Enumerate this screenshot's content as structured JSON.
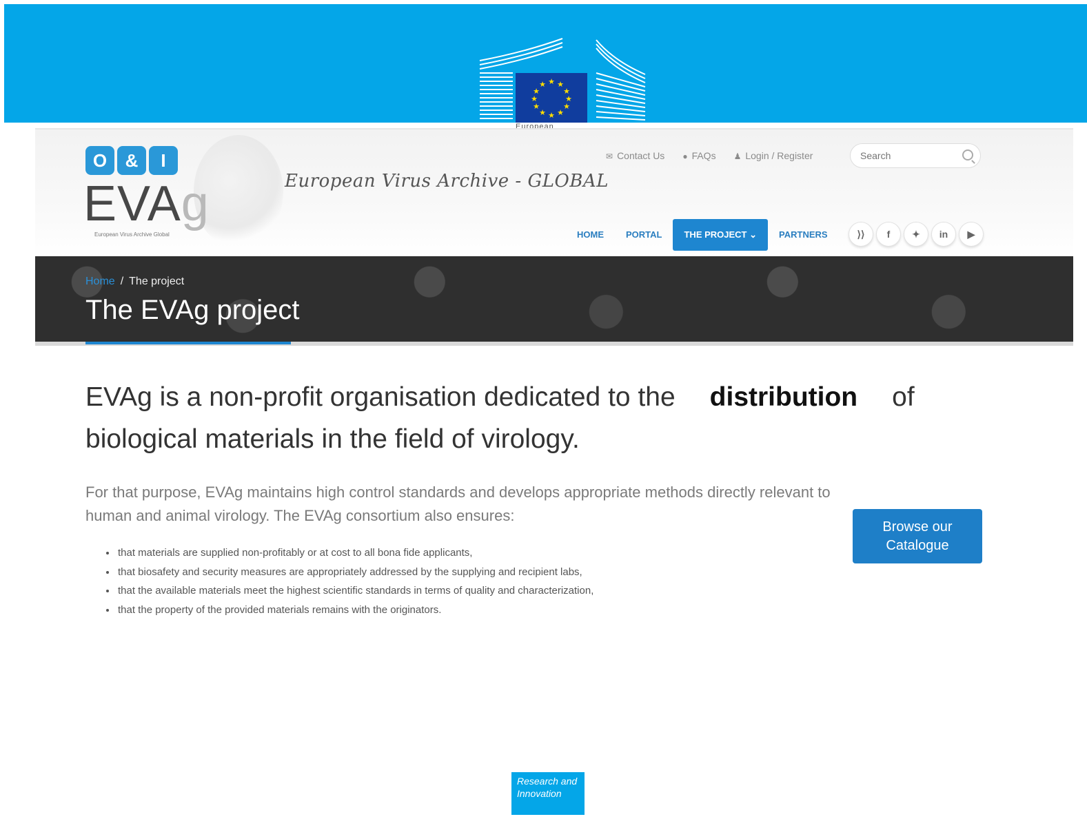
{
  "eu_banner": {
    "logo_caption": "European",
    "colors": {
      "banner": "#04a6e8",
      "flag": "#103d9e",
      "stars": "#ffdd00"
    }
  },
  "logo": {
    "badges": [
      "O",
      "&",
      "I"
    ],
    "main": "EVA",
    "main_suffix": "g",
    "subtitle": "European Virus Archive Global"
  },
  "tagline": "European Virus Archive - GLOBAL",
  "utility_links": [
    {
      "icon": "envelope-icon",
      "label": "Contact Us"
    },
    {
      "icon": "chat-icon",
      "label": "FAQs"
    },
    {
      "icon": "user-icon",
      "label": "Login / Register"
    }
  ],
  "search": {
    "placeholder": "Search"
  },
  "nav": {
    "home": "HOME",
    "portal": "PORTAL",
    "project": "THE PROJECT ⌄",
    "partners": "PARTNERS"
  },
  "social": {
    "rss": "⟩⟩",
    "facebook": "f",
    "twitter": "✦",
    "linkedin": "in",
    "youtube": "▶"
  },
  "breadcrumb": {
    "home": "Home",
    "separator": "/",
    "current": "The project"
  },
  "page_title": "The EVAg project",
  "lead": {
    "before": "EVAg is a non-profit organisation dedicated to the",
    "bold": "distribution",
    "after": "of biological materials in the field of virology."
  },
  "paragraph": "For that purpose, EVAg maintains high control standards and develops appropriate methods directly relevant to human and animal virology. The EVAg consortium also ensures:",
  "bullets": [
    "that materials are supplied non-profitably or at cost to all bona fide applicants,",
    "that biosafety and security measures are appropriately addressed by the supplying and recipient labs,",
    "that the available materials meet the highest scientific standards in terms of quality and characterization,",
    "that the property of the provided materials remains with the originators."
  ],
  "cta_label": "Browse our Catalogue",
  "footer_badge": "Research and Innovation",
  "accent_color": "#1e86d0"
}
